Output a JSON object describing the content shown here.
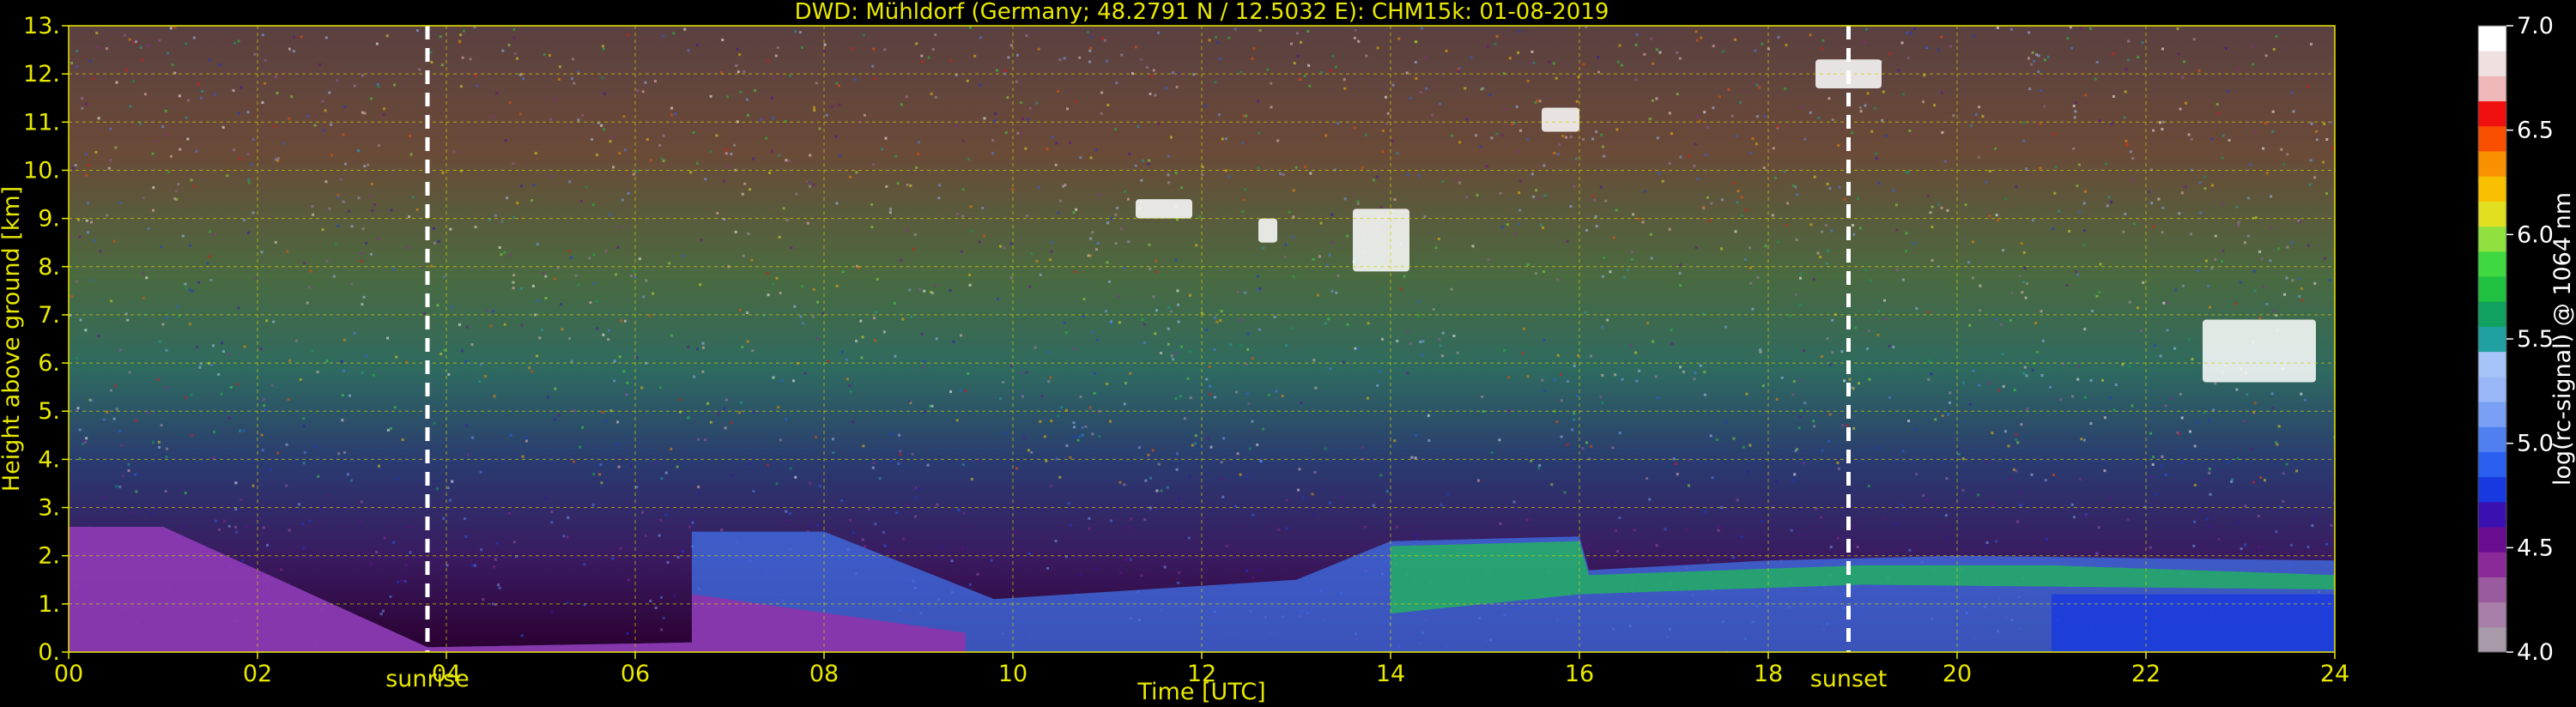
{
  "chart_data": {
    "type": "heatmap",
    "title": "DWD: Mühldorf (Germany; 48.2791 N / 12.5032 E):    CHM15k: 01-08-2019",
    "xlabel": "Time [UTC]",
    "ylabel": "Height above ground [km]",
    "colorbar_label": "log(rc-signal) @ 1064 nm",
    "xlim": [
      0,
      24
    ],
    "ylim": [
      0,
      13
    ],
    "x_tick_labels": [
      "00",
      "02",
      "04",
      "06",
      "08",
      "10",
      "12",
      "14",
      "16",
      "18",
      "20",
      "22",
      "24"
    ],
    "x_ticks": [
      0,
      2,
      4,
      6,
      8,
      10,
      12,
      14,
      16,
      18,
      20,
      22,
      24
    ],
    "y_tick_labels": [
      "0.",
      "1.",
      "2.",
      "3.",
      "4.",
      "5.",
      "6.",
      "7.",
      "8.",
      "9.",
      "10.",
      "11.",
      "12.",
      "13."
    ],
    "y_ticks": [
      0,
      1,
      2,
      3,
      4,
      5,
      6,
      7,
      8,
      9,
      10,
      11,
      12,
      13
    ],
    "colorbar_range": [
      4.0,
      7.0
    ],
    "colorbar_tick_labels": [
      "4.0",
      "4.5",
      "5.0",
      "5.5",
      "6.0",
      "6.5",
      "7.0"
    ],
    "colorbar_ticks": [
      4.0,
      4.5,
      5.0,
      5.5,
      6.0,
      6.5,
      7.0
    ],
    "colormap": [
      "#a89aa8",
      "#a87fa8",
      "#9a5aa0",
      "#8a2a98",
      "#6a0d90",
      "#3a10b0",
      "#1838e0",
      "#2a5ff0",
      "#5080f0",
      "#7aa0f5",
      "#9ab8f8",
      "#a7c4f8",
      "#20a0a0",
      "#10a060",
      "#20c040",
      "#40d840",
      "#90e040",
      "#e0e020",
      "#f8c000",
      "#f89000",
      "#f85000",
      "#f01010",
      "#f0b8b8",
      "#f0e0e0",
      "#ffffff"
    ],
    "grid": true,
    "grid_color": "#d0d000",
    "annotations": [
      {
        "text": "sunrise",
        "x": 3.8
      },
      {
        "text": "sunset",
        "x": 18.85
      }
    ],
    "boundary_layer_top_km": [
      {
        "x": 0,
        "y": 2.6
      },
      {
        "x": 1,
        "y": 2.6
      },
      {
        "x": 3.8,
        "y": 0.1
      },
      {
        "x": 6.6,
        "y": 0.2
      },
      {
        "x": 6.6,
        "y": 2.5
      },
      {
        "x": 8,
        "y": 2.5
      },
      {
        "x": 9.8,
        "y": 1.1
      },
      {
        "x": 13,
        "y": 1.5
      },
      {
        "x": 14,
        "y": 2.3
      },
      {
        "x": 16,
        "y": 2.4
      },
      {
        "x": 16.1,
        "y": 1.7
      },
      {
        "x": 18,
        "y": 1.9
      },
      {
        "x": 20,
        "y": 2.0
      },
      {
        "x": 24,
        "y": 1.9
      }
    ],
    "cloud_features": [
      {
        "x_start": 13.6,
        "x_end": 14.2,
        "y_bottom": 7.9,
        "y_top": 9.2
      },
      {
        "x_start": 11.3,
        "x_end": 11.9,
        "y_bottom": 9.0,
        "y_top": 9.4
      },
      {
        "x_start": 12.6,
        "x_end": 12.8,
        "y_bottom": 8.5,
        "y_top": 9.0
      },
      {
        "x_start": 15.6,
        "x_end": 16.0,
        "y_bottom": 10.8,
        "y_top": 11.3
      },
      {
        "x_start": 18.5,
        "x_end": 19.2,
        "y_bottom": 11.7,
        "y_top": 12.3
      },
      {
        "x_start": 22.6,
        "x_end": 23.8,
        "y_bottom": 5.6,
        "y_top": 6.9
      }
    ]
  }
}
